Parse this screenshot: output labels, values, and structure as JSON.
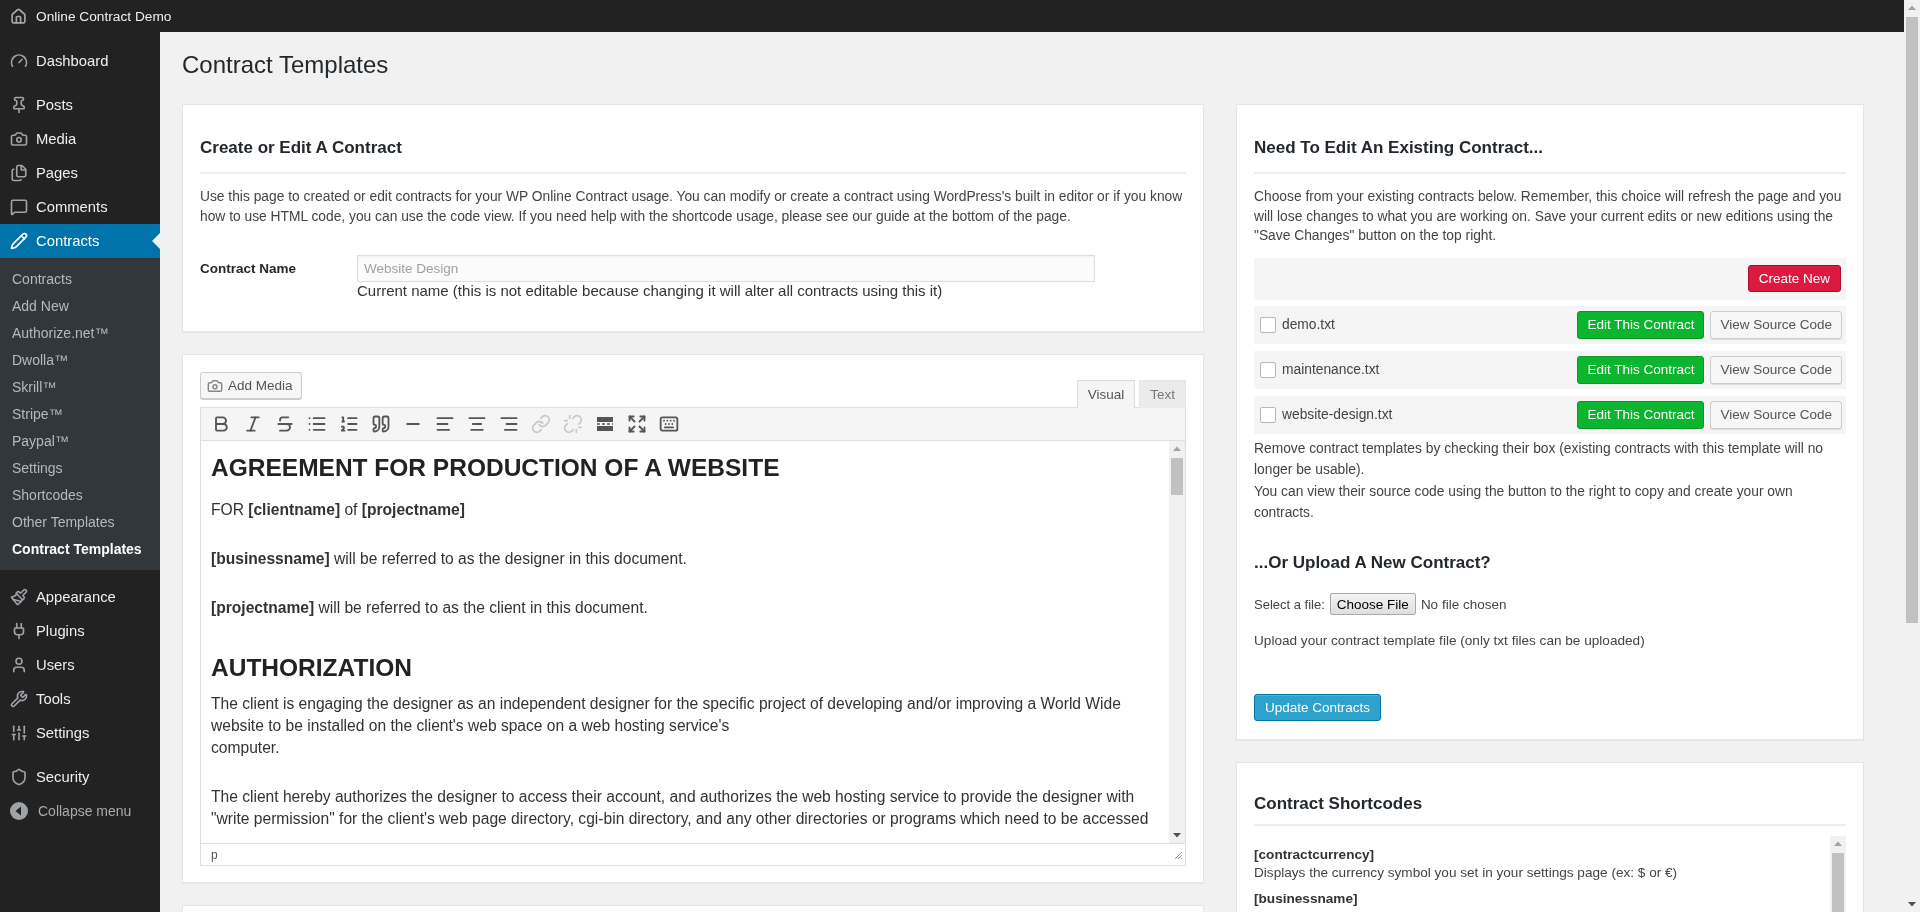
{
  "admin_bar": {
    "site_title": "Online Contract Demo"
  },
  "sidebar": {
    "groups": [
      [
        {
          "label": "Dashboard",
          "selected": false
        }
      ],
      [
        {
          "label": "Posts",
          "selected": false
        },
        {
          "label": "Media",
          "selected": false
        },
        {
          "label": "Pages",
          "selected": false
        },
        {
          "label": "Comments",
          "selected": false
        },
        {
          "label": "Contracts",
          "selected": true,
          "children": [
            {
              "label": "Contracts",
              "selected": false
            },
            {
              "label": "Add New",
              "selected": false
            },
            {
              "label": "Authorize.net™",
              "selected": false
            },
            {
              "label": "Dwolla™",
              "selected": false
            },
            {
              "label": "Skrill™",
              "selected": false
            },
            {
              "label": "Stripe™",
              "selected": false
            },
            {
              "label": "Paypal™",
              "selected": false
            },
            {
              "label": "Settings",
              "selected": false
            },
            {
              "label": "Shortcodes",
              "selected": false
            },
            {
              "label": "Other Templates",
              "selected": false
            },
            {
              "label": "Contract Templates",
              "selected": true
            }
          ]
        }
      ],
      [
        {
          "label": "Appearance",
          "selected": false
        },
        {
          "label": "Plugins",
          "selected": false
        },
        {
          "label": "Users",
          "selected": false
        },
        {
          "label": "Tools",
          "selected": false
        },
        {
          "label": "Settings",
          "selected": false
        }
      ],
      [
        {
          "label": "Security",
          "selected": false
        }
      ]
    ],
    "collapse_label": "Collapse menu"
  },
  "page_title": "Contract Templates",
  "edit_card": {
    "title": "Create or Edit A Contract",
    "description": "Use this page to created or edit contracts for your WP Online Contract usage. You can modify or create a contract using WordPress's built in editor or if you know how to use HTML code, you can use the code view. If you need help with the shortcode usage, please see our guide at the bottom of the page.",
    "name_field": {
      "label": "Contract Name",
      "value": "Website Design",
      "disabled": true,
      "help": "Current name (this is not editable because changing it will alter all contracts using this it)"
    }
  },
  "editor": {
    "add_media": "Add Media",
    "tabs": [
      {
        "label": "Visual",
        "selected": true
      },
      {
        "label": "Text",
        "selected": false
      }
    ],
    "toolbar": [
      {
        "disabled": false
      },
      {
        "disabled": false
      },
      {
        "disabled": false
      },
      {
        "disabled": false
      },
      {
        "disabled": false
      },
      {
        "disabled": false
      },
      {
        "disabled": false
      },
      {
        "disabled": false
      },
      {
        "disabled": false
      },
      {
        "disabled": false
      },
      {
        "disabled": true
      },
      {
        "disabled": true
      },
      {
        "disabled": false
      },
      {
        "disabled": false
      },
      {
        "disabled": false
      }
    ],
    "content": [
      {
        "kind": "heading",
        "text": "AGREEMENT FOR PRODUCTION OF A WEBSITE"
      },
      {
        "kind": "paragraph",
        "text": "FOR **[clientname]** of **[projectname]**"
      },
      {
        "kind": "paragraph",
        "text": "**[businessname]** will be referred to as the designer in this document."
      },
      {
        "kind": "paragraph",
        "text": "**[projectname]** will be referred to as the client in this document."
      },
      {
        "kind": "heading",
        "text": "AUTHORIZATION"
      },
      {
        "kind": "paragraph",
        "text": "The client is engaging the designer as an independent designer for the specific project of developing and/or improving a World Wide website to be installed on the client's web space on a web hosting service's\ncomputer."
      },
      {
        "kind": "paragraph",
        "text": "The client hereby authorizes the designer to access their account, and authorizes the web hosting service to provide the designer with \"write permission\" for the client's web page directory, cgi-bin directory, and any other directories or programs which need to be accessed"
      }
    ],
    "status_path": "p"
  },
  "existing_card": {
    "title": "Need To Edit An Existing Contract...",
    "description": "Choose from your existing contracts below. Remember, this choice will refresh the page and you will lose changes to what you are working on. Save your current edits or new editions using the \"Save Changes\" button on the top right.",
    "create_button": "Create New",
    "contracts": [
      {
        "file": "demo.txt",
        "checked": false,
        "edit_button": "Edit This Contract",
        "view_button": "View Source Code"
      },
      {
        "file": "maintenance.txt",
        "checked": false,
        "edit_button": "Edit This Contract",
        "view_button": "View Source Code"
      },
      {
        "file": "website-design.txt",
        "checked": false,
        "edit_button": "Edit This Contract",
        "view_button": "View Source Code"
      }
    ],
    "notes": [
      "Remove contract templates by checking their box (existing contracts with this template will no longer be usable).",
      "You can view their source code using the button to the right to copy and create your own contracts."
    ],
    "upload": {
      "title": "...Or Upload A New Contract?",
      "file_label": "Select a file:",
      "choose_button": "Choose File",
      "file_status": "No file chosen",
      "hint": "Upload your contract template file (only txt files can be uploaded)"
    },
    "submit_button": "Update Contracts"
  },
  "shortcodes_card": {
    "title": "Contract Shortcodes",
    "items": [
      {
        "code": "[contractcurrency]",
        "description": "Displays the currency symbol you set in your settings page (ex: $ or €)"
      },
      {
        "code": "[businessname]"
      }
    ]
  }
}
